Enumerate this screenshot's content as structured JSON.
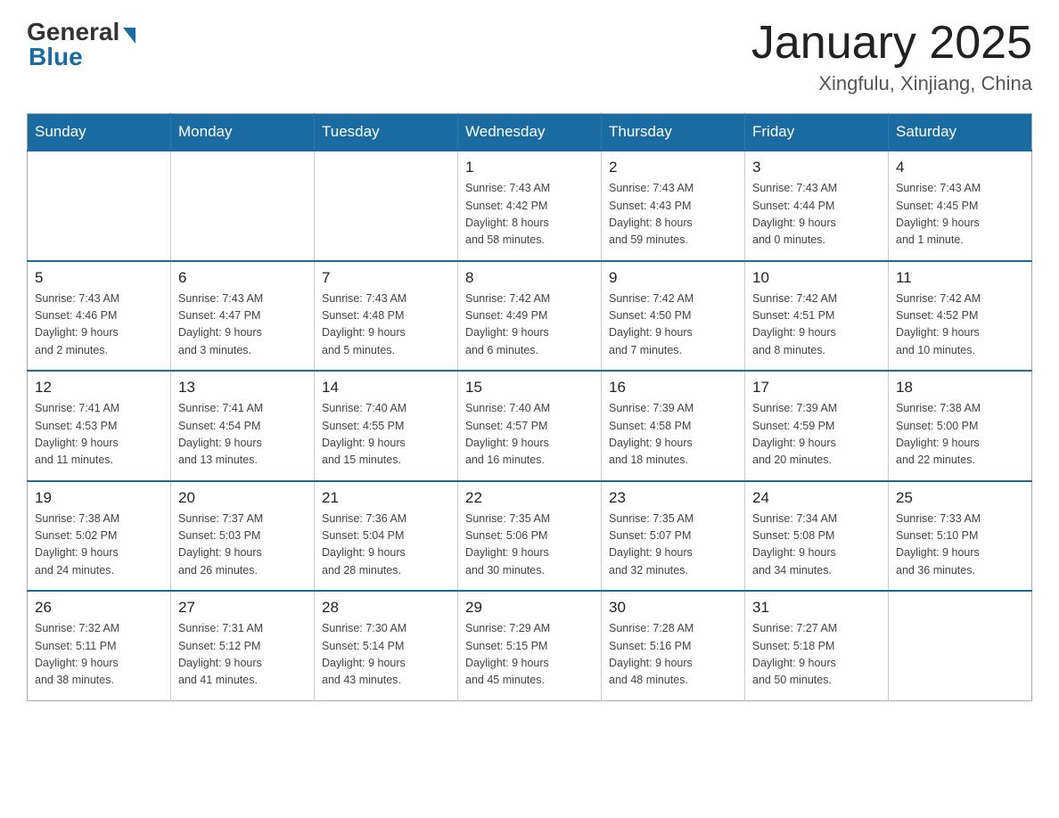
{
  "header": {
    "logo_general": "General",
    "logo_blue": "Blue",
    "month_title": "January 2025",
    "location": "Xingfulu, Xinjiang, China"
  },
  "days_of_week": [
    "Sunday",
    "Monday",
    "Tuesday",
    "Wednesday",
    "Thursday",
    "Friday",
    "Saturday"
  ],
  "weeks": [
    [
      {
        "day": "",
        "info": ""
      },
      {
        "day": "",
        "info": ""
      },
      {
        "day": "",
        "info": ""
      },
      {
        "day": "1",
        "info": "Sunrise: 7:43 AM\nSunset: 4:42 PM\nDaylight: 8 hours\nand 58 minutes."
      },
      {
        "day": "2",
        "info": "Sunrise: 7:43 AM\nSunset: 4:43 PM\nDaylight: 8 hours\nand 59 minutes."
      },
      {
        "day": "3",
        "info": "Sunrise: 7:43 AM\nSunset: 4:44 PM\nDaylight: 9 hours\nand 0 minutes."
      },
      {
        "day": "4",
        "info": "Sunrise: 7:43 AM\nSunset: 4:45 PM\nDaylight: 9 hours\nand 1 minute."
      }
    ],
    [
      {
        "day": "5",
        "info": "Sunrise: 7:43 AM\nSunset: 4:46 PM\nDaylight: 9 hours\nand 2 minutes."
      },
      {
        "day": "6",
        "info": "Sunrise: 7:43 AM\nSunset: 4:47 PM\nDaylight: 9 hours\nand 3 minutes."
      },
      {
        "day": "7",
        "info": "Sunrise: 7:43 AM\nSunset: 4:48 PM\nDaylight: 9 hours\nand 5 minutes."
      },
      {
        "day": "8",
        "info": "Sunrise: 7:42 AM\nSunset: 4:49 PM\nDaylight: 9 hours\nand 6 minutes."
      },
      {
        "day": "9",
        "info": "Sunrise: 7:42 AM\nSunset: 4:50 PM\nDaylight: 9 hours\nand 7 minutes."
      },
      {
        "day": "10",
        "info": "Sunrise: 7:42 AM\nSunset: 4:51 PM\nDaylight: 9 hours\nand 8 minutes."
      },
      {
        "day": "11",
        "info": "Sunrise: 7:42 AM\nSunset: 4:52 PM\nDaylight: 9 hours\nand 10 minutes."
      }
    ],
    [
      {
        "day": "12",
        "info": "Sunrise: 7:41 AM\nSunset: 4:53 PM\nDaylight: 9 hours\nand 11 minutes."
      },
      {
        "day": "13",
        "info": "Sunrise: 7:41 AM\nSunset: 4:54 PM\nDaylight: 9 hours\nand 13 minutes."
      },
      {
        "day": "14",
        "info": "Sunrise: 7:40 AM\nSunset: 4:55 PM\nDaylight: 9 hours\nand 15 minutes."
      },
      {
        "day": "15",
        "info": "Sunrise: 7:40 AM\nSunset: 4:57 PM\nDaylight: 9 hours\nand 16 minutes."
      },
      {
        "day": "16",
        "info": "Sunrise: 7:39 AM\nSunset: 4:58 PM\nDaylight: 9 hours\nand 18 minutes."
      },
      {
        "day": "17",
        "info": "Sunrise: 7:39 AM\nSunset: 4:59 PM\nDaylight: 9 hours\nand 20 minutes."
      },
      {
        "day": "18",
        "info": "Sunrise: 7:38 AM\nSunset: 5:00 PM\nDaylight: 9 hours\nand 22 minutes."
      }
    ],
    [
      {
        "day": "19",
        "info": "Sunrise: 7:38 AM\nSunset: 5:02 PM\nDaylight: 9 hours\nand 24 minutes."
      },
      {
        "day": "20",
        "info": "Sunrise: 7:37 AM\nSunset: 5:03 PM\nDaylight: 9 hours\nand 26 minutes."
      },
      {
        "day": "21",
        "info": "Sunrise: 7:36 AM\nSunset: 5:04 PM\nDaylight: 9 hours\nand 28 minutes."
      },
      {
        "day": "22",
        "info": "Sunrise: 7:35 AM\nSunset: 5:06 PM\nDaylight: 9 hours\nand 30 minutes."
      },
      {
        "day": "23",
        "info": "Sunrise: 7:35 AM\nSunset: 5:07 PM\nDaylight: 9 hours\nand 32 minutes."
      },
      {
        "day": "24",
        "info": "Sunrise: 7:34 AM\nSunset: 5:08 PM\nDaylight: 9 hours\nand 34 minutes."
      },
      {
        "day": "25",
        "info": "Sunrise: 7:33 AM\nSunset: 5:10 PM\nDaylight: 9 hours\nand 36 minutes."
      }
    ],
    [
      {
        "day": "26",
        "info": "Sunrise: 7:32 AM\nSunset: 5:11 PM\nDaylight: 9 hours\nand 38 minutes."
      },
      {
        "day": "27",
        "info": "Sunrise: 7:31 AM\nSunset: 5:12 PM\nDaylight: 9 hours\nand 41 minutes."
      },
      {
        "day": "28",
        "info": "Sunrise: 7:30 AM\nSunset: 5:14 PM\nDaylight: 9 hours\nand 43 minutes."
      },
      {
        "day": "29",
        "info": "Sunrise: 7:29 AM\nSunset: 5:15 PM\nDaylight: 9 hours\nand 45 minutes."
      },
      {
        "day": "30",
        "info": "Sunrise: 7:28 AM\nSunset: 5:16 PM\nDaylight: 9 hours\nand 48 minutes."
      },
      {
        "day": "31",
        "info": "Sunrise: 7:27 AM\nSunset: 5:18 PM\nDaylight: 9 hours\nand 50 minutes."
      },
      {
        "day": "",
        "info": ""
      }
    ]
  ]
}
